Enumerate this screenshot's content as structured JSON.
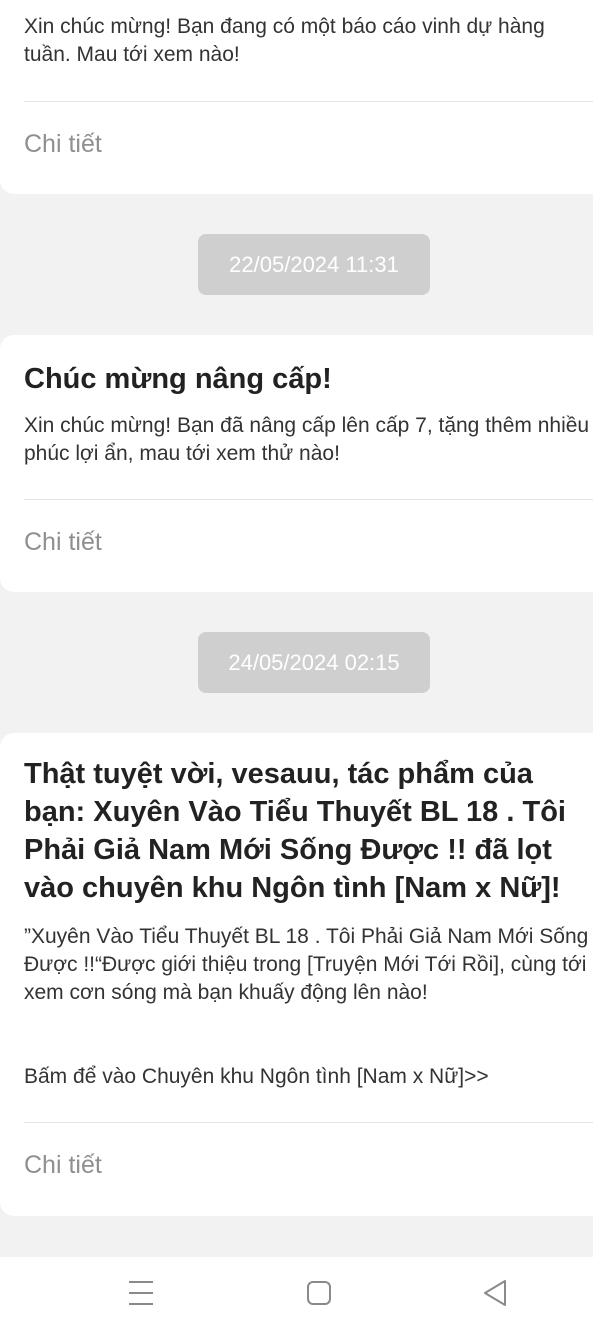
{
  "notifications": [
    {
      "title": "",
      "body": "Xin chúc mừng! Bạn đang có một báo cáo vinh dự hàng tuần. Mau tới xem nào!",
      "detail_label": "Chi tiết"
    },
    {
      "timestamp": "22/05/2024 11:31",
      "title": "Chúc mừng nâng cấp!",
      "body": "Xin chúc mừng! Bạn đã nâng cấp lên cấp 7, tặng thêm nhiều phúc lợi ẩn, mau tới xem thử nào!",
      "detail_label": "Chi tiết"
    },
    {
      "timestamp": "24/05/2024 02:15",
      "title": "Thật tuyệt vời, vesauu, tác phẩm của bạn: Xuyên Vào Tiểu Thuyết BL 18 . Tôi Phải Giả Nam Mới Sống Được !! đã lọt vào chuyên khu Ngôn tình [Nam x Nữ]!",
      "body": "”Xuyên Vào Tiểu Thuyết BL 18 . Tôi Phải Giả Nam Mới Sống Được !!“Được giới thiệu trong [Truyện Mới Tới Rồi], cùng tới xem cơn sóng mà bạn khuấy động lên nào!",
      "link": "Bấm để vào Chuyên khu Ngôn tình [Nam x Nữ]>>",
      "detail_label": "Chi tiết"
    }
  ],
  "navigation": {
    "menu_icon": "menu-icon",
    "home_icon": "home-square-icon",
    "back_icon": "back-triangle-icon"
  },
  "colors": {
    "background": "#f2f2f2",
    "card": "#ffffff",
    "timestamp_pill": "#cfcfcf",
    "muted_text": "#8f8f8f"
  }
}
